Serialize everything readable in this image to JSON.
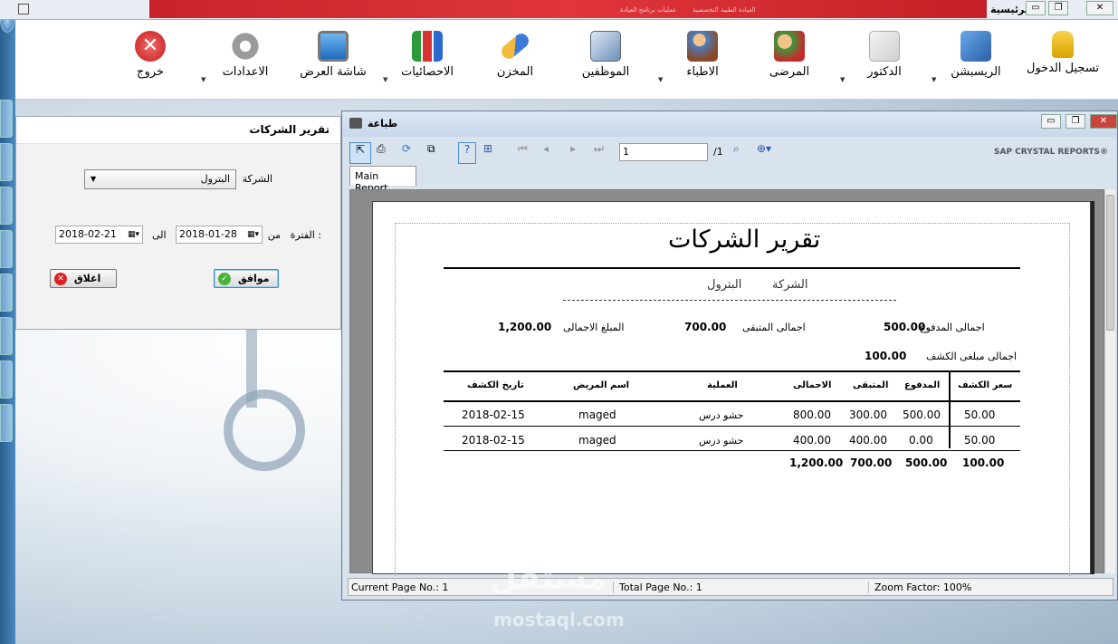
{
  "app": {
    "title": "الرئيسية",
    "red_banner_left": "عمليات برنامج العيادة",
    "red_banner_right": "العيادة الطبية التخصصية"
  },
  "toolbar": [
    {
      "id": "login",
      "label": "تسجيل الدخول",
      "icon": "lock-icon"
    },
    {
      "id": "reception",
      "label": "الريسبشن",
      "icon": "edit-form-icon"
    },
    {
      "id": "doctor",
      "label": "الدكتور",
      "icon": "pencil-paper-icon"
    },
    {
      "id": "patients",
      "label": "المرضى",
      "icon": "patients-icon"
    },
    {
      "id": "doctors",
      "label": "الاطباء",
      "icon": "users-icon"
    },
    {
      "id": "employees",
      "label": "الموظفين",
      "icon": "employee-book-icon"
    },
    {
      "id": "store",
      "label": "المخزن",
      "icon": "pill-icon"
    },
    {
      "id": "stats",
      "label": "الاحصائيات",
      "icon": "bar-chart-icon"
    },
    {
      "id": "display",
      "label": "شاشة العرض",
      "icon": "monitor-icon"
    },
    {
      "id": "settings",
      "label": "الاعدادات",
      "icon": "gear-icon"
    },
    {
      "id": "exit",
      "label": "خروج",
      "icon": "exit-icon"
    }
  ],
  "filter_dialog": {
    "title": "تقرير الشركات",
    "company_label": "الشركة",
    "company_value": "البترول",
    "period_label": "الفترة :",
    "from_label": "من",
    "to_label": "الى",
    "from_date": "2018-01-28",
    "to_date": "2018-02-21",
    "ok_label": "موافق",
    "close_label": "اغلاق"
  },
  "report_window": {
    "title": "طباعة",
    "page_input": "1",
    "page_total": "/1",
    "brand": "SAP CRYSTAL REPORTS®",
    "tab": "Main Report",
    "status": {
      "current": "Current Page No.: 1",
      "total": "Total Page No.: 1",
      "zoom": "Zoom Factor: 100%"
    }
  },
  "report": {
    "heading": "تقرير الشركات",
    "company_label": "الشركة",
    "company_value": "البترول",
    "paid_label": "اجمالى المدفوع",
    "paid_value": "500.00",
    "remaining_label": "اجمالى المتبقى",
    "remaining_value": "700.00",
    "total_label": "المبلغ الاجمالى",
    "total_value": "1,200.00",
    "exam_total_label": "اجمالى مبلغى الكشف",
    "exam_total_value": "100.00",
    "columns": [
      "سعر الكشف",
      "المدفوع",
      "المتبقى",
      "الاجمالى",
      "العملية",
      "اسم المريض",
      "تاريخ الكشف"
    ],
    "rows": [
      [
        "50.00",
        "500.00",
        "300.00",
        "800.00",
        "حشو درس",
        "maged",
        "2018-02-15"
      ],
      [
        "50.00",
        "0.00",
        "400.00",
        "400.00",
        "حشو درس",
        "maged",
        "2018-02-15"
      ]
    ],
    "totals": [
      "100.00",
      "500.00",
      "700.00",
      "1,200.00"
    ]
  },
  "watermark": {
    "arabic": "مستقل",
    "latin": "mostaql.com"
  }
}
